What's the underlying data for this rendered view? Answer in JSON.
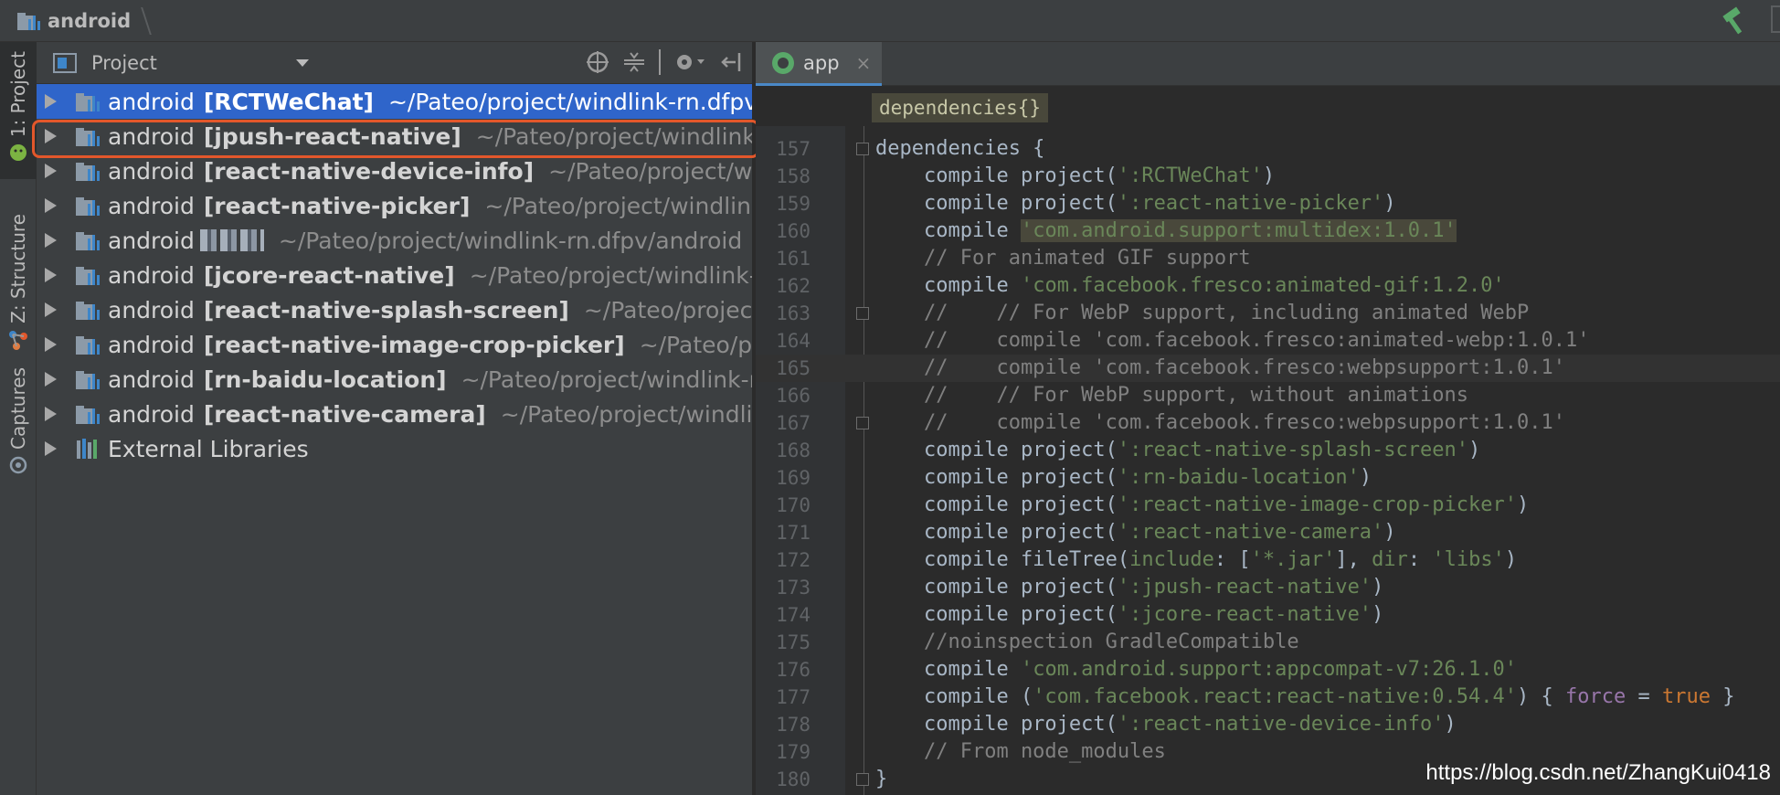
{
  "breadcrumb": {
    "root": "android"
  },
  "toolwindows": {
    "project_label": "1: Project",
    "structure_label": "Z: Structure",
    "captures_label": "Captures"
  },
  "project_panel": {
    "title": "Project",
    "tree": [
      {
        "name": "android",
        "module": "[RCTWeChat]",
        "path": "~/Pateo/project/windlink-rn.dfpv/",
        "selected": true
      },
      {
        "name": "android",
        "module": "[jpush-react-native]",
        "path": "~/Pateo/project/windlink-r"
      },
      {
        "name": "android",
        "module": "[react-native-device-info]",
        "path": "~/Pateo/project/win"
      },
      {
        "name": "android",
        "module": "[react-native-picker]",
        "path": "~/Pateo/project/windlink-"
      },
      {
        "name": "android",
        "module": "",
        "path": "~/Pateo/project/windlink-rn.dfpv/android",
        "blurred": true
      },
      {
        "name": "android",
        "module": "[jcore-react-native]",
        "path": "~/Pateo/project/windlink-r"
      },
      {
        "name": "android",
        "module": "[react-native-splash-screen]",
        "path": "~/Pateo/project/w"
      },
      {
        "name": "android",
        "module": "[react-native-image-crop-picker]",
        "path": "~/Pateo/pro"
      },
      {
        "name": "android",
        "module": "[rn-baidu-location]",
        "path": "~/Pateo/project/windlink-rn"
      },
      {
        "name": "android",
        "module": "[react-native-camera]",
        "path": "~/Pateo/project/windlink"
      },
      {
        "name": "External Libraries",
        "module": "",
        "path": ""
      }
    ]
  },
  "editor": {
    "tab": {
      "label": "app",
      "close": "×"
    },
    "breadcrumb": "dependencies{}",
    "lines": [
      {
        "n": "157",
        "parts": [
          [
            "t",
            "dependencies {"
          ]
        ]
      },
      {
        "n": "158",
        "parts": [
          [
            "t",
            "    compile project("
          ],
          [
            "s",
            "':RCTWeChat'"
          ],
          [
            "t",
            ")"
          ]
        ]
      },
      {
        "n": "159",
        "parts": [
          [
            "t",
            "    compile project("
          ],
          [
            "s",
            "':react-native-picker'"
          ],
          [
            "t",
            ")"
          ]
        ]
      },
      {
        "n": "160",
        "parts": [
          [
            "t",
            "    compile "
          ],
          [
            "sh",
            "'com.android.support:multidex:1.0.1'"
          ]
        ]
      },
      {
        "n": "161",
        "parts": [
          [
            "c",
            "    // For animated GIF support"
          ]
        ]
      },
      {
        "n": "162",
        "parts": [
          [
            "t",
            "    compile "
          ],
          [
            "s",
            "'com.facebook.fresco:animated-gif:1.2.0'"
          ]
        ]
      },
      {
        "n": "163",
        "parts": [
          [
            "c",
            "    //    // For WebP support, including animated WebP"
          ]
        ]
      },
      {
        "n": "164",
        "parts": [
          [
            "c",
            "    //    compile 'com.facebook.fresco:animated-webp:1.0.1'"
          ]
        ]
      },
      {
        "n": "165",
        "parts": [
          [
            "c",
            "    //    compile 'com.facebook.fresco:webpsupport:1.0.1'"
          ]
        ],
        "current": true
      },
      {
        "n": "166",
        "parts": [
          [
            "c",
            "    //    // For WebP support, without animations"
          ]
        ]
      },
      {
        "n": "167",
        "parts": [
          [
            "c",
            "    //    compile 'com.facebook.fresco:webpsupport:1.0.1'"
          ]
        ]
      },
      {
        "n": "168",
        "parts": [
          [
            "t",
            "    compile project("
          ],
          [
            "s",
            "':react-native-splash-screen'"
          ],
          [
            "t",
            ")"
          ]
        ]
      },
      {
        "n": "169",
        "parts": [
          [
            "t",
            "    compile project("
          ],
          [
            "s",
            "':rn-baidu-location'"
          ],
          [
            "t",
            ")"
          ]
        ]
      },
      {
        "n": "170",
        "parts": [
          [
            "t",
            "    compile project("
          ],
          [
            "s",
            "':react-native-image-crop-picker'"
          ],
          [
            "t",
            ")"
          ]
        ]
      },
      {
        "n": "171",
        "parts": [
          [
            "t",
            "    compile project("
          ],
          [
            "s",
            "':react-native-camera'"
          ],
          [
            "t",
            ")"
          ]
        ]
      },
      {
        "n": "172",
        "parts": [
          [
            "t",
            "    compile fileTree("
          ],
          [
            "s",
            "include"
          ],
          [
            "t",
            ": ["
          ],
          [
            "s",
            "'*.jar'"
          ],
          [
            "t",
            "], "
          ],
          [
            "s",
            "dir"
          ],
          [
            "t",
            ": "
          ],
          [
            "s",
            "'libs'"
          ],
          [
            "t",
            ")"
          ]
        ]
      },
      {
        "n": "173",
        "parts": [
          [
            "t",
            "    compile project("
          ],
          [
            "s",
            "':jpush-react-native'"
          ],
          [
            "t",
            ")"
          ]
        ]
      },
      {
        "n": "174",
        "parts": [
          [
            "t",
            "    compile project("
          ],
          [
            "s",
            "':jcore-react-native'"
          ],
          [
            "t",
            ")"
          ]
        ]
      },
      {
        "n": "175",
        "parts": [
          [
            "c",
            "    //noinspection GradleCompatible"
          ]
        ]
      },
      {
        "n": "176",
        "parts": [
          [
            "t",
            "    compile "
          ],
          [
            "s",
            "'com.android.support:appcompat-v7:26.1.0'"
          ]
        ]
      },
      {
        "n": "177",
        "parts": [
          [
            "t",
            "    compile ("
          ],
          [
            "s",
            "'com.facebook.react:react-native:0.54.4'"
          ],
          [
            "t",
            ") { "
          ],
          [
            "p",
            "force"
          ],
          [
            "t",
            " = "
          ],
          [
            "k",
            "true"
          ],
          [
            "t",
            " }"
          ]
        ]
      },
      {
        "n": "178",
        "parts": [
          [
            "t",
            "    compile project("
          ],
          [
            "s",
            "':react-native-device-info'"
          ],
          [
            "t",
            ")"
          ]
        ]
      },
      {
        "n": "179",
        "parts": [
          [
            "c",
            "    // From node_modules"
          ]
        ]
      },
      {
        "n": "180",
        "parts": [
          [
            "t",
            "}"
          ]
        ]
      }
    ]
  },
  "watermark": "https://blog.csdn.net/ZhangKui0418",
  "colors": {
    "selection": "#2f65ca",
    "highlight_border": "#e3572b",
    "string": "#6a8759",
    "keyword": "#cc7832",
    "comment": "#808080"
  }
}
